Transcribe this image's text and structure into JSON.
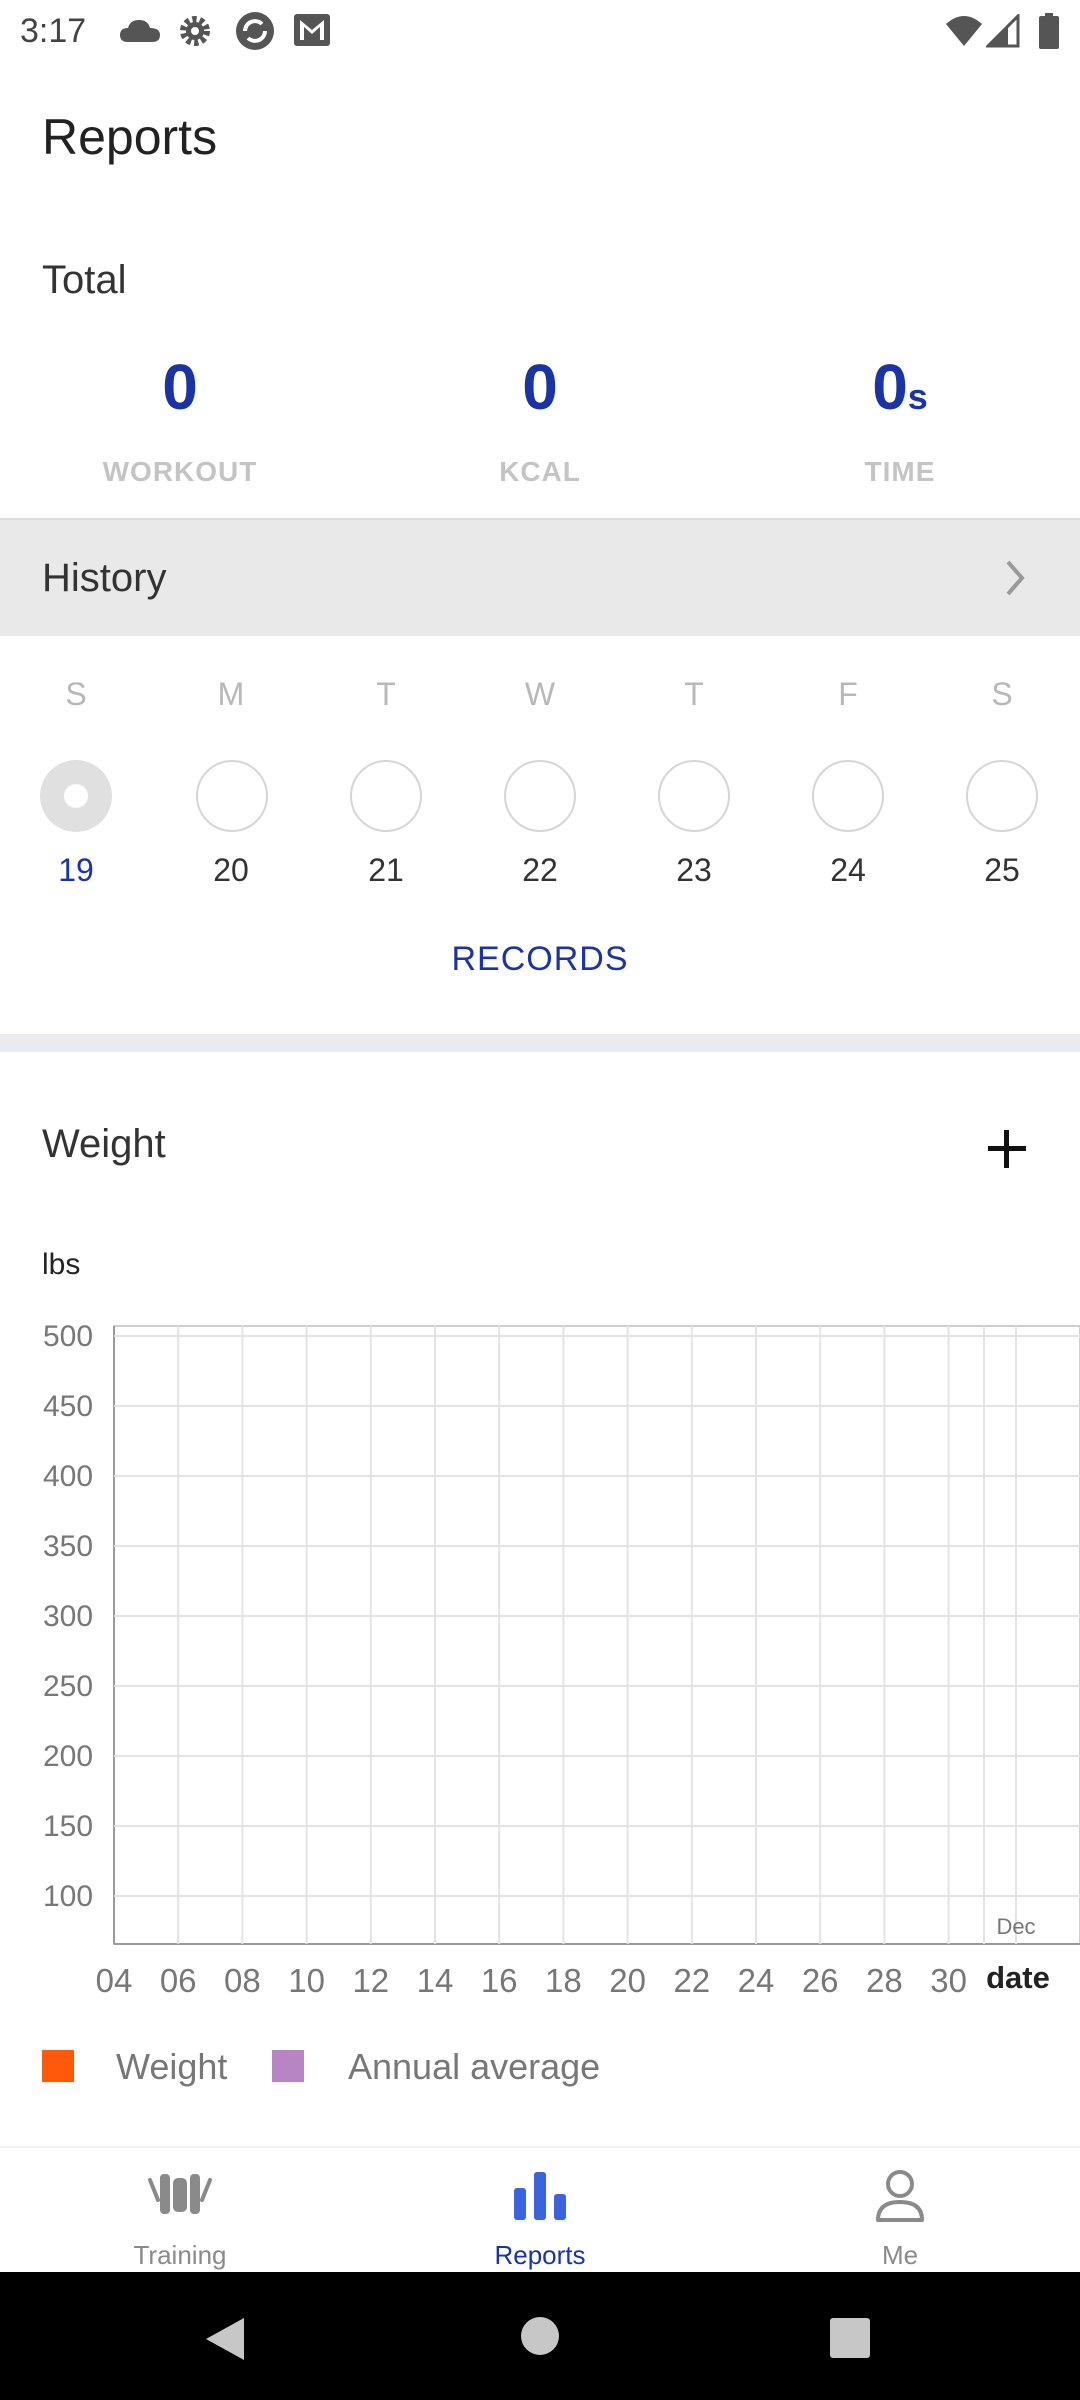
{
  "status_bar": {
    "time": "3:17"
  },
  "header": {
    "title": "Reports"
  },
  "total": {
    "title": "Total",
    "stats": [
      {
        "value": "0",
        "unit": "",
        "label": "WORKOUT"
      },
      {
        "value": "0",
        "unit": "",
        "label": "KCAL"
      },
      {
        "value": "0",
        "unit": "s",
        "label": "TIME"
      }
    ]
  },
  "history": {
    "title": "History",
    "week": [
      {
        "letter": "S",
        "date": "19",
        "today": true
      },
      {
        "letter": "M",
        "date": "20",
        "today": false
      },
      {
        "letter": "T",
        "date": "21",
        "today": false
      },
      {
        "letter": "W",
        "date": "22",
        "today": false
      },
      {
        "letter": "T",
        "date": "23",
        "today": false
      },
      {
        "letter": "F",
        "date": "24",
        "today": false
      },
      {
        "letter": "S",
        "date": "25",
        "today": false
      }
    ],
    "records_label": "RECORDS"
  },
  "weight": {
    "title": "Weight",
    "unit_label": "lbs"
  },
  "chart_data": {
    "type": "line",
    "title": "",
    "ylabel": "lbs",
    "xlabel": "date",
    "y_ticks": [
      "500",
      "450",
      "400",
      "350",
      "300",
      "250",
      "200",
      "150",
      "100"
    ],
    "x_ticks": [
      "04",
      "06",
      "08",
      "10",
      "12",
      "14",
      "16",
      "18",
      "20",
      "22",
      "24",
      "26",
      "28",
      "30"
    ],
    "month_label": "Dec",
    "ylim": [
      100,
      500
    ],
    "series": [
      {
        "name": "Weight",
        "color": "#ff5a0a",
        "values": []
      },
      {
        "name": "Annual average",
        "color": "#b784c4",
        "values": []
      }
    ],
    "grid": true,
    "legend_position": "bottom-left"
  },
  "nav": {
    "items": [
      {
        "label": "Training",
        "icon": "dumbbell-icon"
      },
      {
        "label": "Reports",
        "icon": "bar-chart-icon"
      },
      {
        "label": "Me",
        "icon": "person-icon"
      }
    ],
    "active": "Reports"
  },
  "colors": {
    "accent": "#1a33a6",
    "nav_active": "#3b63e0",
    "weight_series": "#ff5a0a",
    "average_series": "#b784c4"
  }
}
